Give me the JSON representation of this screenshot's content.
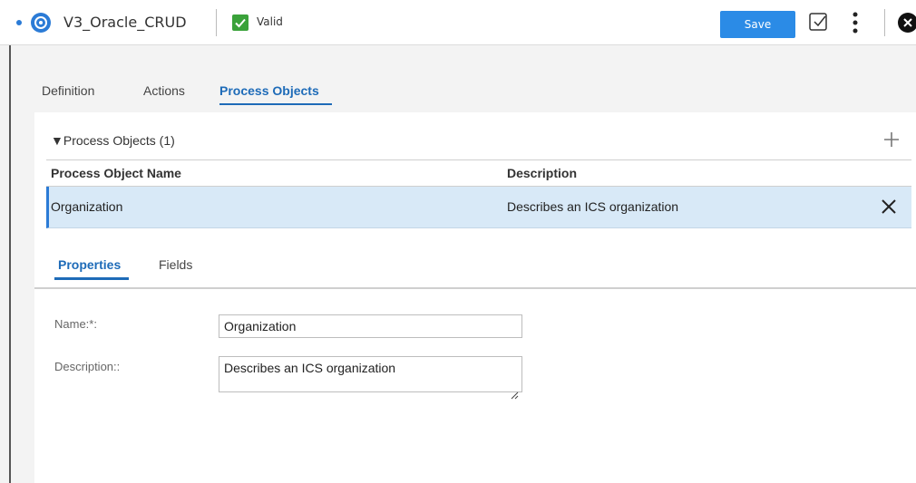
{
  "header": {
    "title": "V3_Oracle_CRUD",
    "status": "Valid",
    "save_label": "Save"
  },
  "top_tabs": [
    {
      "label": "Definition"
    },
    {
      "label": "Actions"
    },
    {
      "label": "Process Objects"
    }
  ],
  "process_objects": {
    "heading": "Process Objects (1)",
    "columns": [
      "Process Object Name",
      "Description"
    ],
    "rows": [
      {
        "name": "Organization",
        "description": "Describes an ICS organization"
      }
    ]
  },
  "bottom_tabs": [
    {
      "label": "Properties"
    },
    {
      "label": "Fields"
    }
  ],
  "form": {
    "name_label": "Name:*:",
    "name_value": "Organization",
    "description_label": "Description::",
    "description_value": "Describes an ICS organization"
  },
  "colors": {
    "accent": "#2b7bd6",
    "valid_green": "#3aa23a",
    "selected_row": "#d8e9f7"
  },
  "icons": [
    "process-icon",
    "valid-check-icon",
    "validate-icon",
    "more-vertical-icon",
    "close-circle-icon",
    "plus-icon",
    "remove-row-icon",
    "triangle-down-icon",
    "resize-handle-icon"
  ]
}
